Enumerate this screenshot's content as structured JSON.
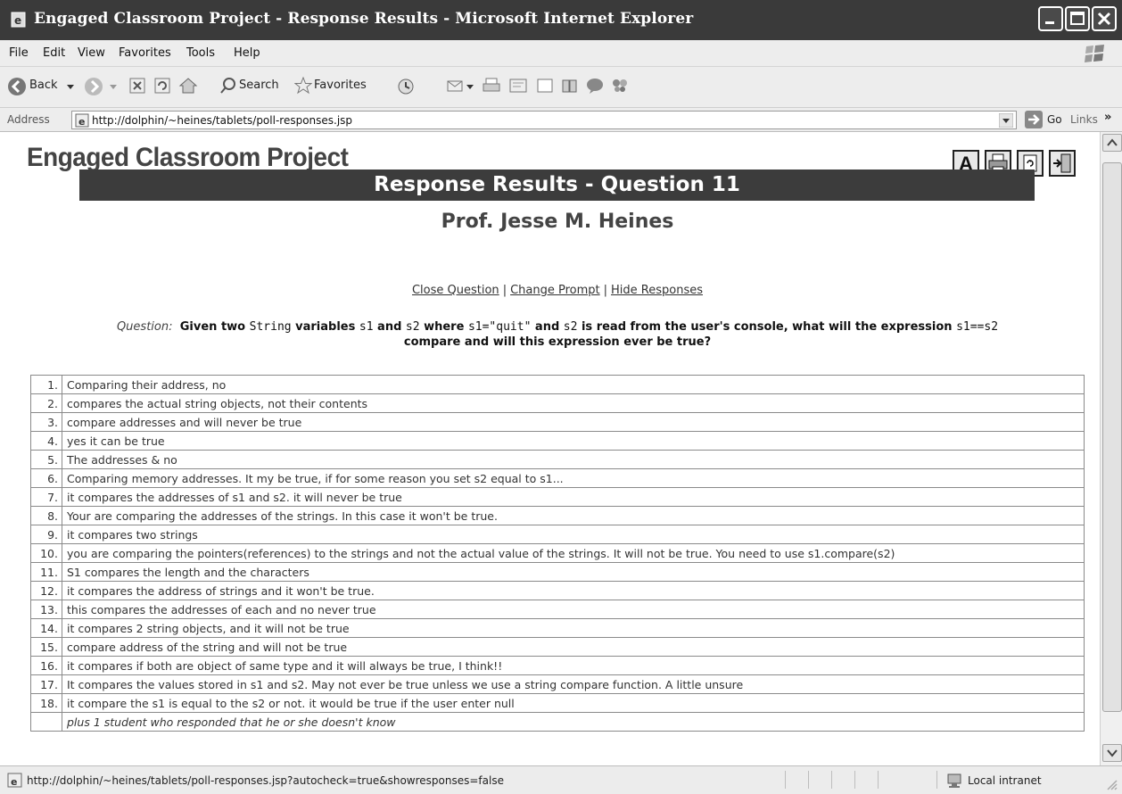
{
  "window": {
    "title": "Engaged Classroom Project - Response Results - Microsoft Internet Explorer"
  },
  "menu": {
    "items": [
      "File",
      "Edit",
      "View",
      "Favorites",
      "Tools",
      "Help"
    ]
  },
  "toolbar": {
    "back_label": "Back",
    "search_label": "Search",
    "favorites_label": "Favorites"
  },
  "address": {
    "label": "Address",
    "url": "http://dolphin/~heines/tablets/poll-responses.jsp",
    "go_label": "Go",
    "links_label": "Links"
  },
  "page": {
    "site_title": "Engaged Classroom Project",
    "tools": [
      "text-size-icon",
      "print-icon",
      "refresh-icon",
      "exit-icon"
    ],
    "banner": "Response Results - Question 11",
    "professor": "Prof. Jesse M. Heines",
    "actions": {
      "close_question": "Close Question",
      "change_prompt": "Change Prompt",
      "hide_responses": "Hide Responses",
      "separator": "|"
    },
    "question": {
      "label": "Question:",
      "text_1": "Given two ",
      "code_1": "String",
      "text_2": " variables ",
      "code_2": "s1",
      "text_3": " and ",
      "code_3": "s2",
      "text_4": " where ",
      "code_4": "s1=\"quit\"",
      "text_5": " and ",
      "code_5": "s2",
      "text_6": " is read from the user's console, what will the expression ",
      "code_6": "s1==s2",
      "text_7": " compare and will this expression ever be true?"
    },
    "responses": [
      {
        "n": "1.",
        "text": "Comparing their address, no"
      },
      {
        "n": "2.",
        "text": "compares the actual string objects, not their contents"
      },
      {
        "n": "3.",
        "text": "compare addresses and will never be true"
      },
      {
        "n": "4.",
        "text": "yes it can be true"
      },
      {
        "n": "5.",
        "text": "The addresses & no"
      },
      {
        "n": "6.",
        "text": "Comparing memory addresses. It my be true, if for some reason you set s2 equal to s1..."
      },
      {
        "n": "7.",
        "text": "it compares the addresses of s1 and s2. it will never be true"
      },
      {
        "n": "8.",
        "text": "Your are comparing the addresses of the strings. In this case it won't be true."
      },
      {
        "n": "9.",
        "text": "it compares two strings"
      },
      {
        "n": "10.",
        "text": "you are comparing the pointers(references) to the strings and not the actual value of the strings. It will not be true. You need to use s1.compare(s2)"
      },
      {
        "n": "11.",
        "text": "S1 compares the length and the characters"
      },
      {
        "n": "12.",
        "text": "it compares the address of strings and it won't be true."
      },
      {
        "n": "13.",
        "text": "this compares the addresses of each and no never true"
      },
      {
        "n": "14.",
        "text": "it compares 2 string objects, and it will not be true"
      },
      {
        "n": "15.",
        "text": "compare address of the string and will not be true"
      },
      {
        "n": "16.",
        "text": "it compares if both are object of same type and it will always be true, I think!!"
      },
      {
        "n": "17.",
        "text": "It compares the values stored in s1 and s2. May not ever be true unless we use a string compare function. A little unsure"
      },
      {
        "n": "18.",
        "text": "it compare the s1 is equal to the s2 or not. it would be true if the user enter null"
      }
    ],
    "dont_know": "plus 1 student who responded that he or she doesn't know"
  },
  "status": {
    "url": "http://dolphin/~heines/tablets/poll-responses.jsp?autocheck=true&showresponses=false",
    "zone": "Local intranet"
  }
}
